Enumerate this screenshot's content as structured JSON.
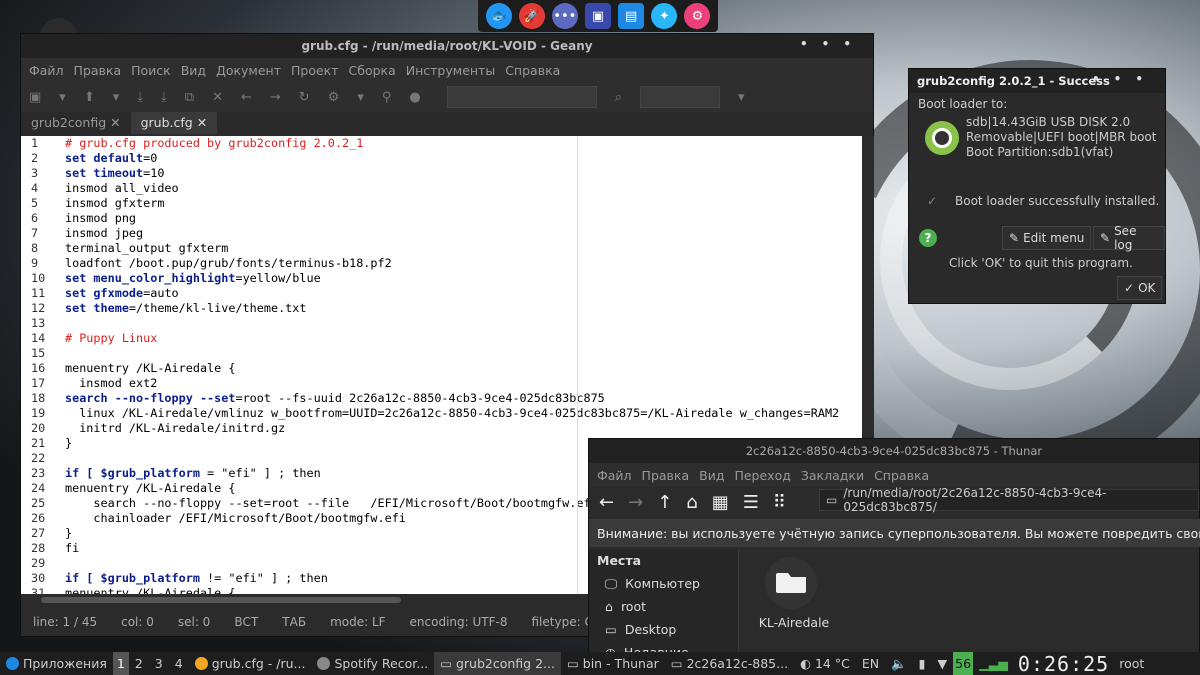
{
  "dock": {
    "icons": [
      "fish-icon",
      "rocket-icon",
      "chat-icon",
      "terminal-icon",
      "file-manager-icon",
      "settings-icon",
      "gear-icon"
    ]
  },
  "geany": {
    "title": "grub.cfg - /run/media/root/KL-VOID - Geany",
    "menu": [
      "Файл",
      "Правка",
      "Поиск",
      "Вид",
      "Документ",
      "Проект",
      "Сборка",
      "Инструменты",
      "Справка"
    ],
    "tabs": [
      "grub2config",
      "grub.cfg"
    ],
    "tab_close": "✕",
    "status": {
      "line": "line: 1 / 45",
      "col": "col: 0",
      "sel": "sel: 0",
      "ins": "ВСТ",
      "tab": "ТАБ",
      "mode": "mode: LF",
      "encoding": "encoding: UTF-8",
      "filetype": "filetype: Conf"
    },
    "lines": [
      {
        "n": "1",
        "parts": [
          [
            "cm",
            "# grub.cfg produced by grub2config 2.0.2_1"
          ]
        ]
      },
      {
        "n": "2",
        "parts": [
          [
            "kw",
            "set default"
          ],
          [
            "",
            "=0"
          ]
        ]
      },
      {
        "n": "3",
        "parts": [
          [
            "kw",
            "set timeout"
          ],
          [
            "",
            "=10"
          ]
        ]
      },
      {
        "n": "4",
        "parts": [
          [
            "",
            "insmod all_video"
          ]
        ]
      },
      {
        "n": "5",
        "parts": [
          [
            "",
            "insmod gfxterm"
          ]
        ]
      },
      {
        "n": "6",
        "parts": [
          [
            "",
            "insmod png"
          ]
        ]
      },
      {
        "n": "7",
        "parts": [
          [
            "",
            "insmod jpeg"
          ]
        ]
      },
      {
        "n": "8",
        "parts": [
          [
            "",
            "terminal_output gfxterm"
          ]
        ]
      },
      {
        "n": "9",
        "parts": [
          [
            "",
            "loadfont /boot.pup/grub/fonts/terminus-b18.pf2"
          ]
        ]
      },
      {
        "n": "10",
        "parts": [
          [
            "kw",
            "set menu_color_highlight"
          ],
          [
            "",
            "=yellow/blue"
          ]
        ]
      },
      {
        "n": "11",
        "parts": [
          [
            "kw",
            "set gfxmode"
          ],
          [
            "",
            "=auto"
          ]
        ]
      },
      {
        "n": "12",
        "parts": [
          [
            "kw",
            "set theme"
          ],
          [
            "",
            "=/theme/kl-live/theme.txt"
          ]
        ]
      },
      {
        "n": "13",
        "parts": []
      },
      {
        "n": "14",
        "parts": [
          [
            "cm",
            "# Puppy Linux"
          ]
        ]
      },
      {
        "n": "15",
        "parts": []
      },
      {
        "n": "16",
        "parts": [
          [
            "",
            "menuentry /KL-Airedale {"
          ]
        ]
      },
      {
        "n": "17",
        "parts": [
          [
            "",
            "  insmod ext2"
          ]
        ]
      },
      {
        "n": "18",
        "parts": [
          [
            "kw",
            "search --no-floppy --set"
          ],
          [
            "",
            "=root --fs-uuid 2c26a12c-8850-4cb3-9ce4-025dc83bc875"
          ]
        ]
      },
      {
        "n": "19",
        "parts": [
          [
            "",
            "  linux /KL-Airedale/vmlinuz w_bootfrom=UUID=2c26a12c-8850-4cb3-9ce4-025dc83bc875=/KL-Airedale w_changes=RAM2"
          ]
        ]
      },
      {
        "n": "20",
        "parts": [
          [
            "",
            "  initrd /KL-Airedale/initrd.gz"
          ]
        ]
      },
      {
        "n": "21",
        "parts": [
          [
            "",
            "}"
          ]
        ]
      },
      {
        "n": "22",
        "parts": []
      },
      {
        "n": "23",
        "parts": [
          [
            "kw",
            "if [ $grub_platform"
          ],
          [
            "",
            " = \"efi\" ] ; then"
          ]
        ]
      },
      {
        "n": "24",
        "parts": [
          [
            "",
            "menuentry /KL-Airedale {"
          ]
        ]
      },
      {
        "n": "25",
        "parts": [
          [
            "",
            "    search --no-floppy --set=root --file   /EFI/Microsoft/Boot/bootmgfw.efi"
          ]
        ]
      },
      {
        "n": "26",
        "parts": [
          [
            "",
            "    chainloader /EFI/Microsoft/Boot/bootmgfw.efi"
          ]
        ]
      },
      {
        "n": "27",
        "parts": [
          [
            "",
            "}"
          ]
        ]
      },
      {
        "n": "28",
        "parts": [
          [
            "",
            "fi"
          ]
        ]
      },
      {
        "n": "29",
        "parts": []
      },
      {
        "n": "30",
        "parts": [
          [
            "kw",
            "if [ $grub_platform"
          ],
          [
            "",
            " != \"efi\" ] ; then"
          ]
        ]
      },
      {
        "n": "31",
        "parts": [
          [
            "",
            "menuentry /KL-Airedale {"
          ]
        ]
      }
    ]
  },
  "dialog": {
    "title": "grub2config 2.0.2_1 - Success",
    "header": "Boot loader to:",
    "disk_line1": "sdb|14.43GiB  USB DISK 2.0",
    "disk_line2": "Removable|UEFI boot|MBR boot",
    "disk_line3": "Boot Partition:sdb1(vfat)",
    "success": "Boot loader successfully installed.",
    "edit_menu": "Edit menu",
    "see_log": "See log",
    "quit_hint": "Click 'OK' to quit this program.",
    "ok": "OK"
  },
  "thunar": {
    "title": "2c26a12c-8850-4cb3-9ce4-025dc83bc875 - Thunar",
    "menu": [
      "Файл",
      "Правка",
      "Вид",
      "Переход",
      "Закладки",
      "Справка"
    ],
    "path": "/run/media/root/2c26a12c-8850-4cb3-9ce4-025dc83bc875/",
    "warning": "Внимание: вы используете учётную запись суперпользователя. Вы можете повредить свою систему.",
    "places_header": "Места",
    "places": [
      "Компьютер",
      "root",
      "Desktop",
      "Недавние"
    ],
    "folder": "KL-Airedale"
  },
  "taskbar": {
    "apps_label": "Приложения",
    "workspaces": [
      "1",
      "2",
      "3",
      "4"
    ],
    "tasks": [
      "grub.cfg - /ru...",
      "Spotify Recor...",
      "grub2config 2...",
      "bin - Thunar",
      "2c26a12c-885..."
    ],
    "weather": "14 °C",
    "lang": "EN",
    "battery": "56",
    "clock": "0:26:25",
    "user": "root"
  }
}
